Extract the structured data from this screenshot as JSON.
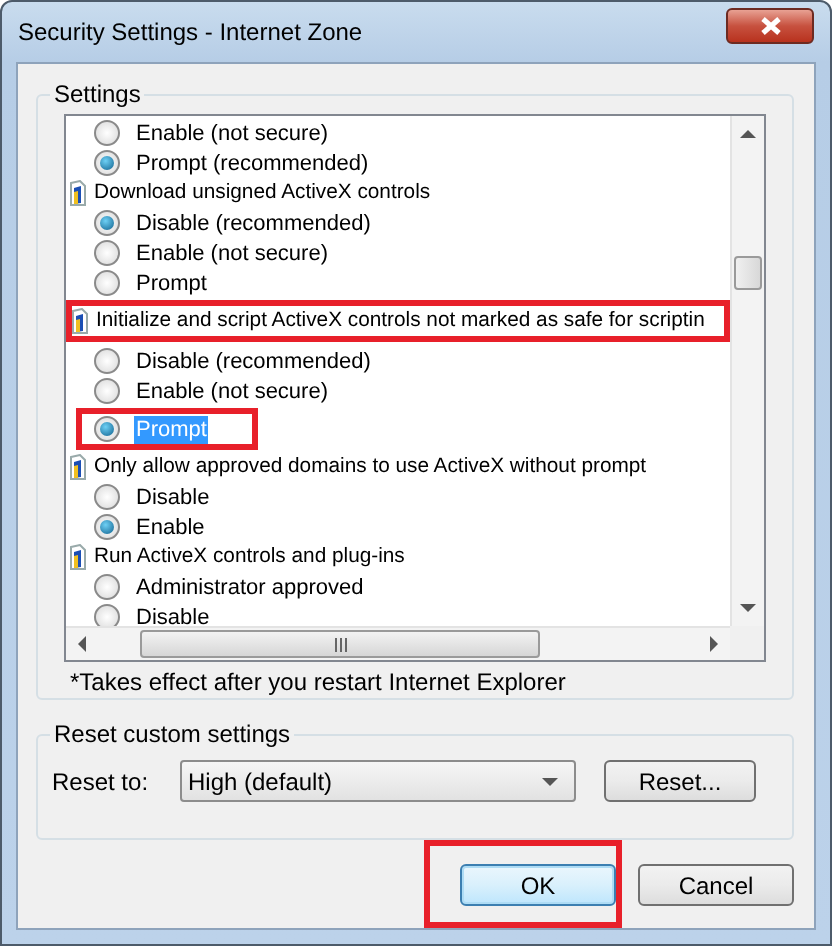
{
  "window": {
    "title": "Security Settings - Internet Zone"
  },
  "settings": {
    "title": "Settings",
    "groups": [
      {
        "options": [
          {
            "label": "Enable (not secure)",
            "selected": false,
            "focused": false,
            "highlighted": false
          },
          {
            "label": "Prompt (recommended)",
            "selected": true,
            "focused": false,
            "highlighted": false
          }
        ]
      },
      {
        "heading": "Download unsigned ActiveX controls",
        "highlighted": false,
        "options": [
          {
            "label": "Disable (recommended)",
            "selected": true,
            "focused": false,
            "highlighted": false
          },
          {
            "label": "Enable (not secure)",
            "selected": false,
            "focused": false,
            "highlighted": false
          },
          {
            "label": "Prompt",
            "selected": false,
            "focused": false,
            "highlighted": false
          }
        ]
      },
      {
        "heading": "Initialize and script ActiveX controls not marked as safe for scriptin",
        "highlighted": true,
        "options": [
          {
            "label": "Disable (recommended)",
            "selected": false,
            "focused": false,
            "highlighted": false
          },
          {
            "label": "Enable (not secure)",
            "selected": false,
            "focused": false,
            "highlighted": false
          },
          {
            "label": "Prompt",
            "selected": true,
            "focused": true,
            "highlighted": true
          }
        ]
      },
      {
        "heading": "Only allow approved domains to use ActiveX without prompt",
        "highlighted": false,
        "options": [
          {
            "label": "Disable",
            "selected": false,
            "focused": false,
            "highlighted": false
          },
          {
            "label": "Enable",
            "selected": true,
            "focused": false,
            "highlighted": false
          }
        ]
      },
      {
        "heading": "Run ActiveX controls and plug-ins",
        "highlighted": false,
        "options": [
          {
            "label": "Administrator approved",
            "selected": false,
            "focused": false,
            "highlighted": false
          },
          {
            "label": "Disable",
            "selected": false,
            "focused": false,
            "highlighted": false
          }
        ]
      }
    ],
    "note": "*Takes effect after you restart Internet Explorer"
  },
  "reset": {
    "title": "Reset custom settings",
    "label": "Reset to:",
    "value": "High (default)",
    "button": "Reset..."
  },
  "buttons": [
    {
      "label": "OK",
      "default": true,
      "highlighted": true
    },
    {
      "label": "Cancel",
      "default": false,
      "highlighted": false
    }
  ]
}
